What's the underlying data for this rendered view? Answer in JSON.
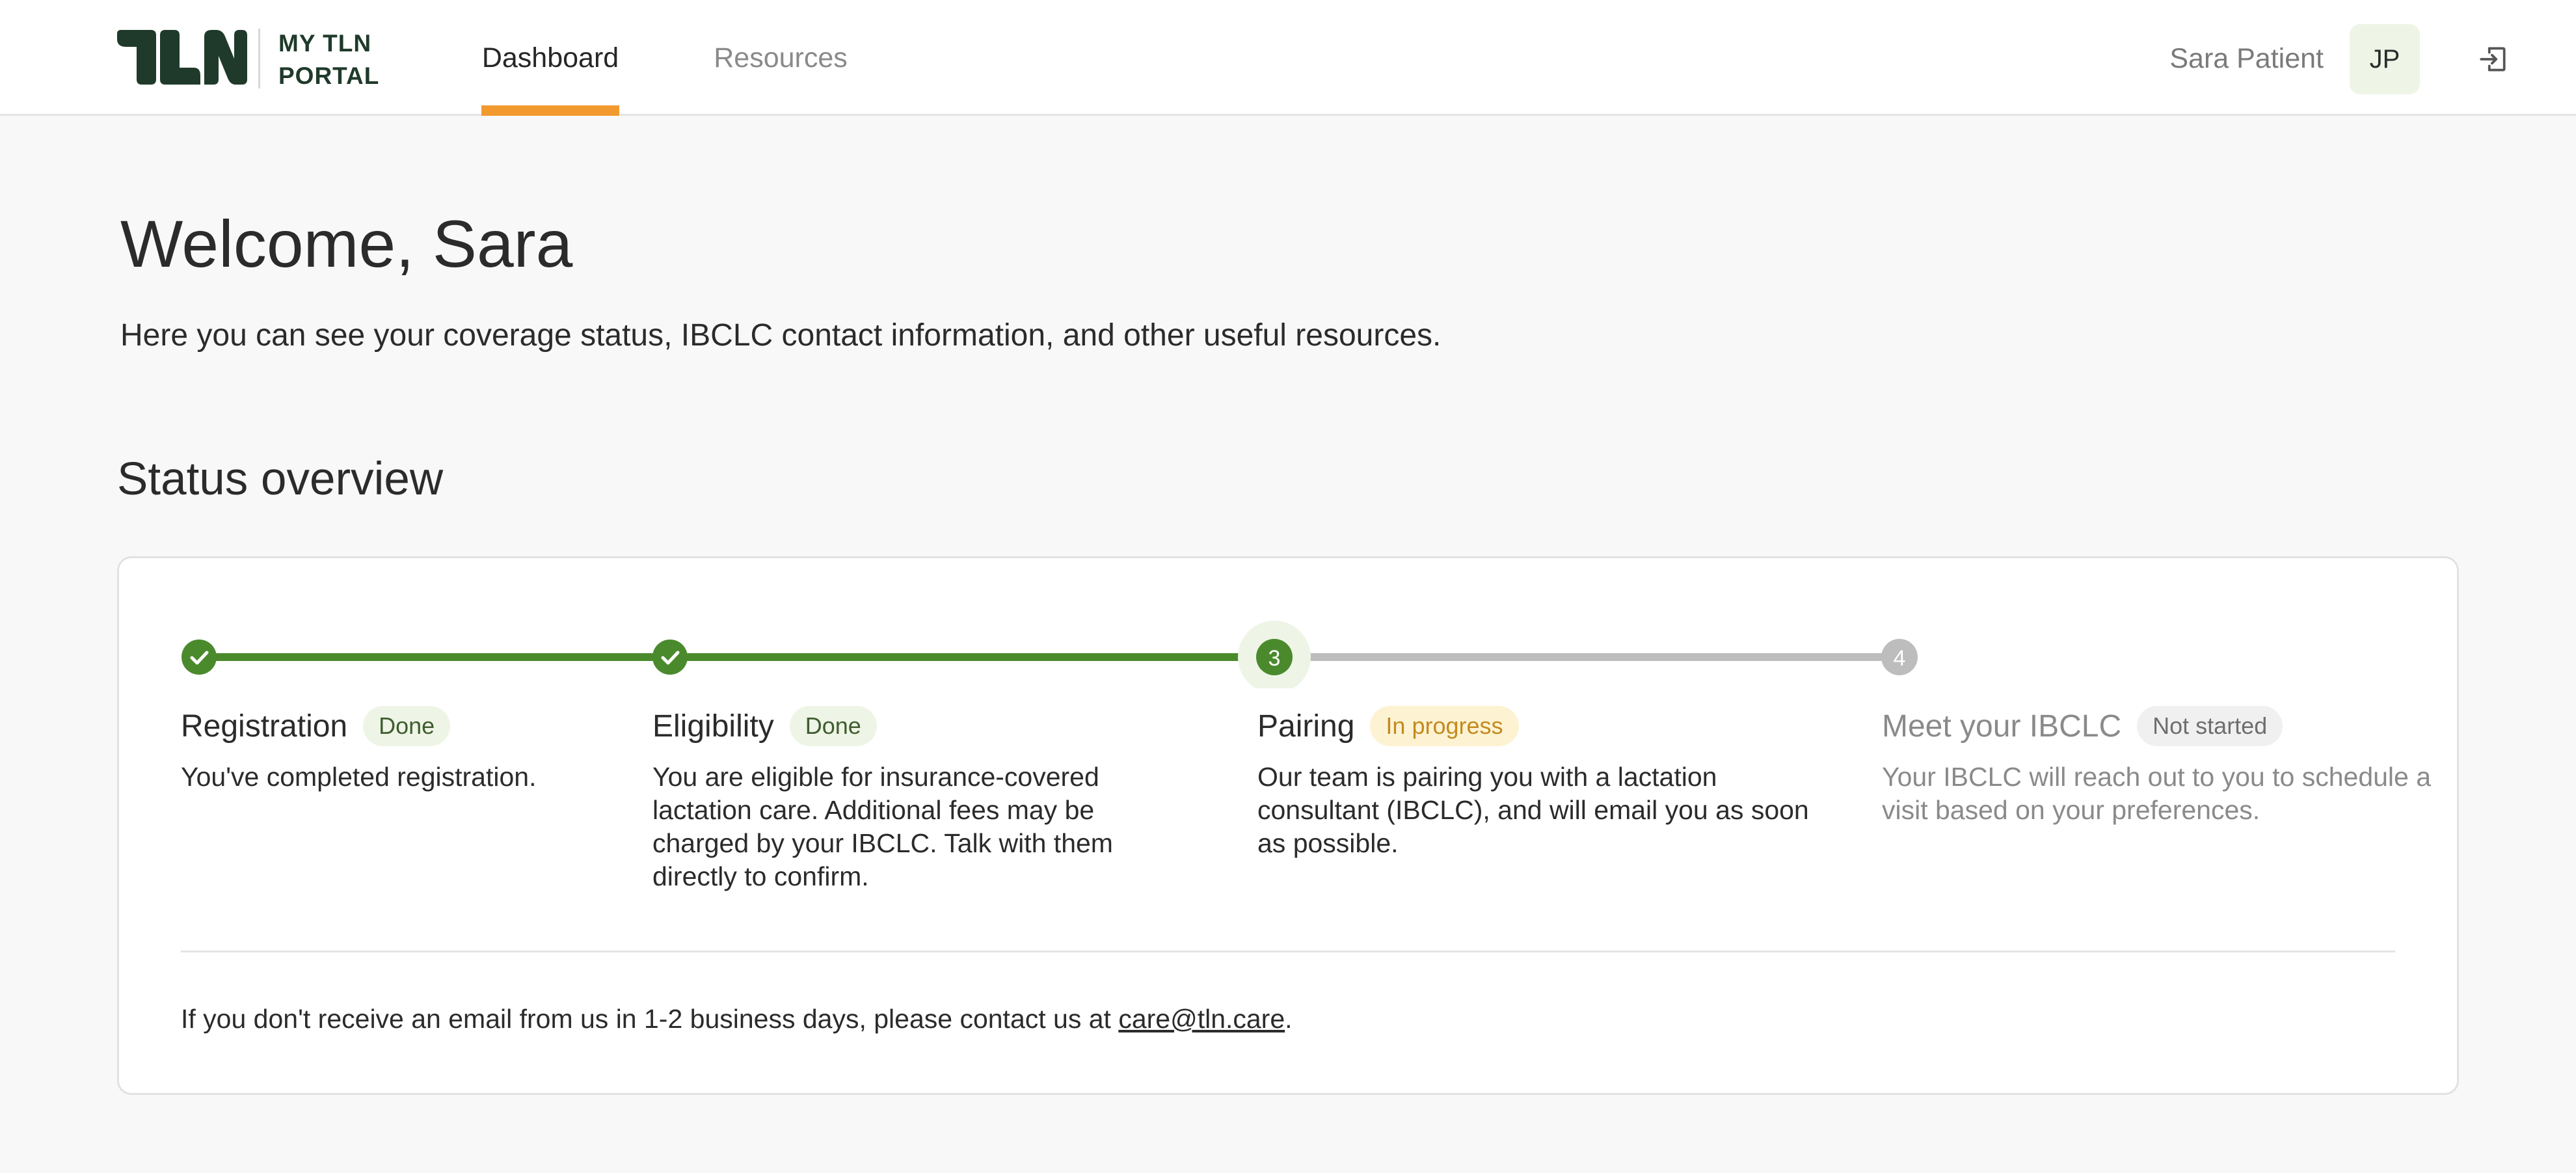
{
  "header": {
    "logo_text_line1": "MY TLN",
    "logo_text_line2": "PORTAL",
    "tabs": [
      {
        "label": "Dashboard",
        "active": true
      },
      {
        "label": "Resources",
        "active": false
      }
    ],
    "user_name": "Sara Patient",
    "avatar_initials": "JP",
    "logout_icon": "logout-icon"
  },
  "welcome": {
    "title": "Welcome, Sara",
    "subtitle": "Here you can see your coverage status, IBCLC contact information, and other useful resources."
  },
  "status": {
    "title": "Status overview",
    "steps": [
      {
        "number": "1",
        "title": "Registration",
        "badge": "Done",
        "state": "done",
        "description": "You've completed registration."
      },
      {
        "number": "2",
        "title": "Eligibility",
        "badge": "Done",
        "state": "done",
        "description": "You are eligible for insurance-covered lactation care. Additional fees may be charged by your IBCLC. Talk with them directly to confirm."
      },
      {
        "number": "3",
        "title": "Pairing",
        "badge": "In progress",
        "state": "in-progress",
        "description": "Our team is pairing you with a lactation consultant (IBCLC), and will email you as soon as possible."
      },
      {
        "number": "4",
        "title": "Meet your IBCLC",
        "badge": "Not started",
        "state": "not-started",
        "description": "Your IBCLC will reach out to you to schedule a visit based on your preferences."
      }
    ],
    "footer_prefix": "If you don't receive an email from us in 1-2 business days, please contact us at ",
    "footer_email": "care@tln.care",
    "footer_suffix": "."
  },
  "colors": {
    "accent_orange": "#f29a30",
    "brand_green": "#4a8a2c",
    "logo_green": "#1f3a2a",
    "inactive_gray": "#bdbdbd"
  }
}
